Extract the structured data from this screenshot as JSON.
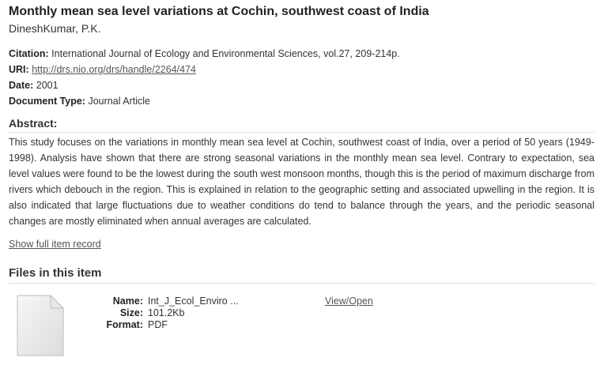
{
  "item": {
    "title": "Monthly mean sea level variations at Cochin, southwest coast of India",
    "author": "DineshKumar, P.K."
  },
  "metadata": {
    "citation_label": "Citation:",
    "citation_value": "International Journal of Ecology and Environmental Sciences, vol.27, 209-214p.",
    "uri_label": "URI:",
    "uri_value": "http://drs.nio.org/drs/handle/2264/474",
    "date_label": "Date:",
    "date_value": "2001",
    "doctype_label": "Document Type:",
    "doctype_value": "Journal Article"
  },
  "abstract": {
    "heading": "Abstract:",
    "text": "This study focuses on the variations in monthly mean sea level at Cochin, southwest coast of India, over a period of 50 years (1949-1998). Analysis have shown that there are strong seasonal variations in the monthly mean sea level. Contrary to expectation, sea level values were found to be the lowest during the south west monsoon months, though this is the period of maximum discharge from rivers which debouch in the region. This is explained in relation to the geographic setting and associated upwelling in the region. It is also indicated that large fluctuations due to weather conditions do tend to balance through the years, and the periodic seasonal changes are mostly eliminated when annual averages are calculated."
  },
  "links": {
    "full_record": "Show full item record"
  },
  "files": {
    "heading": "Files in this item",
    "icon": "document-file-icon",
    "name_label": "Name:",
    "name_value": "Int_J_Ecol_Enviro ...",
    "size_label": "Size:",
    "size_value": "101.2Kb",
    "format_label": "Format:",
    "format_value": "PDF",
    "action": "View/Open"
  }
}
